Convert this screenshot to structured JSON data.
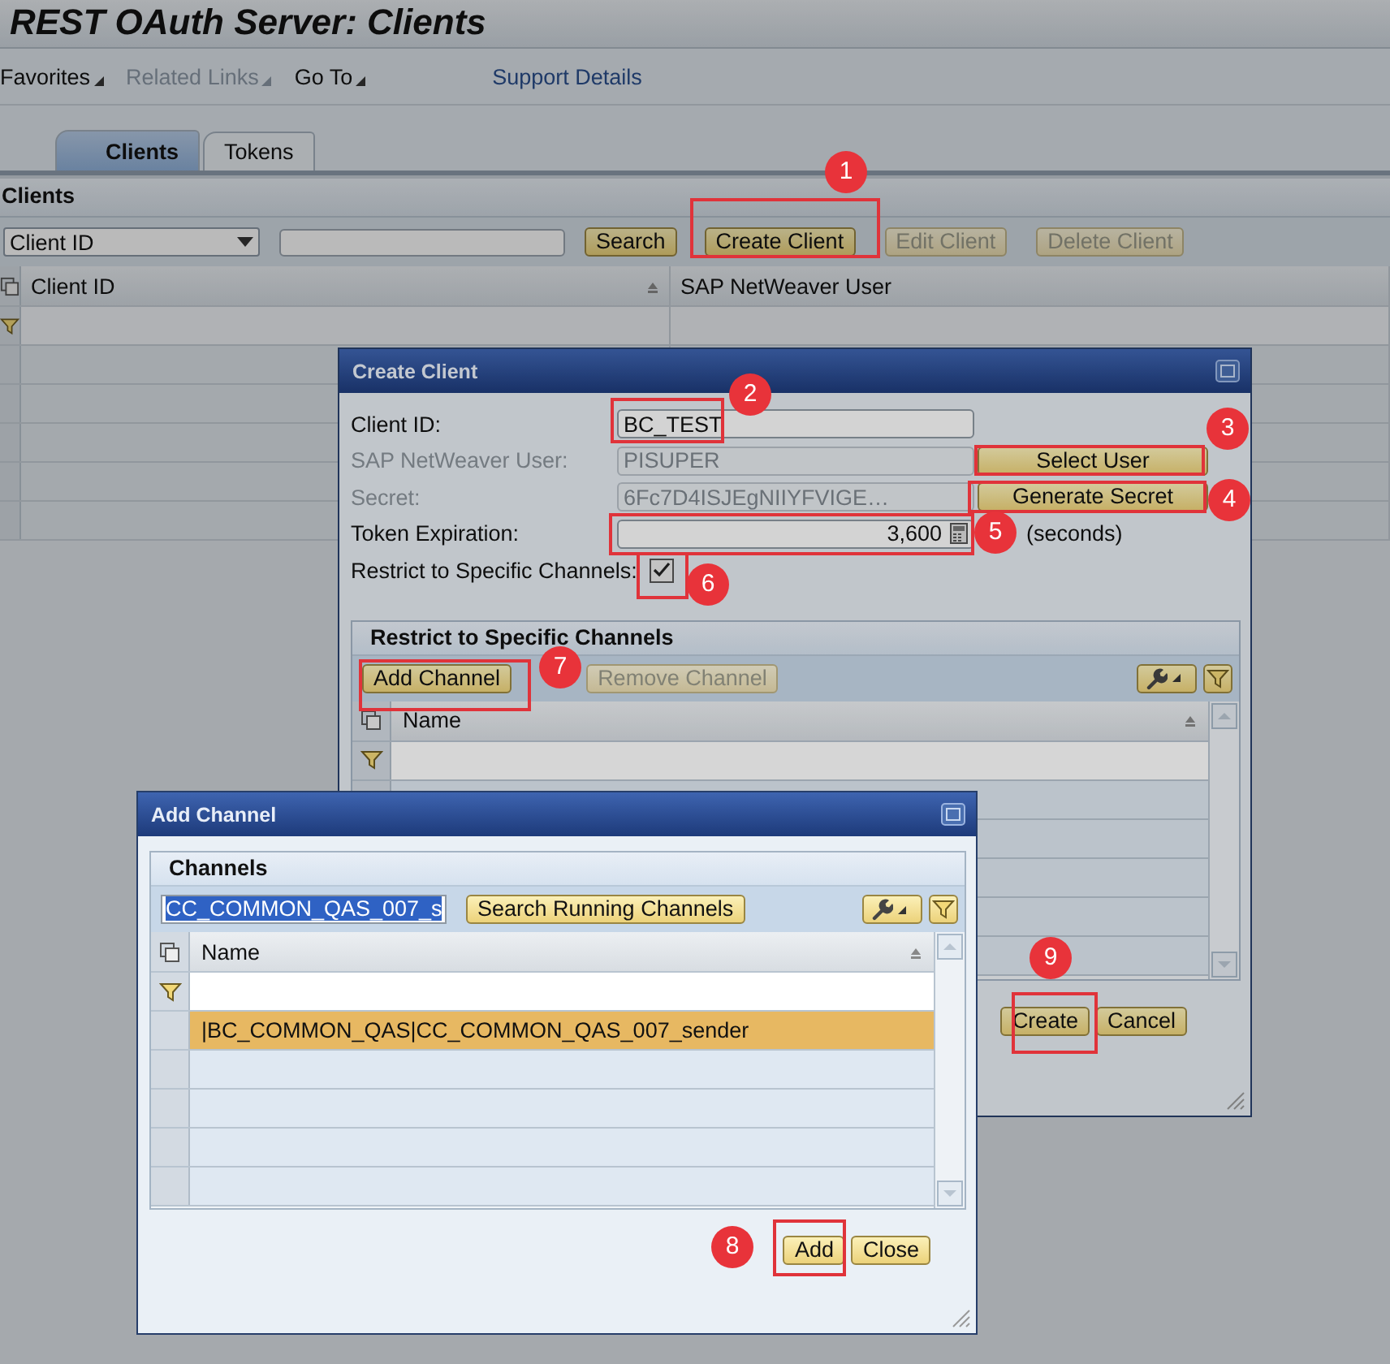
{
  "window": {
    "title": "REST OAuth Server: Clients"
  },
  "menu": [
    {
      "label": "Favorites",
      "disabled": false
    },
    {
      "label": "Related Links",
      "disabled": true
    },
    {
      "label": "Go To",
      "disabled": false
    }
  ],
  "support_link": "Support Details",
  "tabs": [
    {
      "label": "Clients",
      "selected": true
    },
    {
      "label": "Tokens",
      "selected": false
    }
  ],
  "clients_panel": {
    "title": "Clients",
    "search_by": "Client ID",
    "search_button": "Search",
    "buttons": [
      {
        "label": "Create Client",
        "disabled": false
      },
      {
        "label": "Edit Client",
        "disabled": true
      },
      {
        "label": "Delete Client",
        "disabled": true
      }
    ],
    "columns": [
      "Client ID",
      "SAP NetWeaver User"
    ]
  },
  "create_client_dialog": {
    "title": "Create Client",
    "fields": [
      {
        "kind": "text",
        "label": "Client ID:",
        "value": "BC_TEST",
        "disabled": false
      },
      {
        "kind": "text",
        "label": "SAP NetWeaver User:",
        "value": "PISUPER",
        "disabled": true,
        "button": "Select User"
      },
      {
        "kind": "text",
        "label": "Secret:",
        "value": "6Fc7D4ISJEgNIIYFVIGE…",
        "disabled": true,
        "button": "Generate Secret"
      },
      {
        "kind": "number",
        "label": "Token Expiration:",
        "value": "3,600",
        "disabled": false,
        "suffix": "(seconds)"
      },
      {
        "kind": "checkbox",
        "label": "Restrict to Specific Channels:",
        "checked": true,
        "disabled": false
      }
    ],
    "channels_panel": {
      "title": "Restrict to Specific Channels",
      "buttons": [
        {
          "label": "Add Channel",
          "disabled": false
        },
        {
          "label": "Remove Channel",
          "disabled": true
        }
      ],
      "columns": [
        "Name"
      ]
    },
    "buttons": [
      "Create",
      "Cancel"
    ]
  },
  "add_channel_dialog": {
    "title": "Add Channel",
    "panel_title": "Channels",
    "search_value": "CC_COMMON_QAS_007_s",
    "search_button": "Search Running Channels",
    "columns": [
      "Name"
    ],
    "rows": [
      {
        "name": "|BC_COMMON_QAS|CC_COMMON_QAS_007_sender",
        "selected": true
      }
    ],
    "buttons": [
      "Add",
      "Close"
    ]
  },
  "annotations": [
    {
      "number": "1"
    },
    {
      "number": "2"
    },
    {
      "number": "3"
    },
    {
      "number": "4"
    },
    {
      "number": "5"
    },
    {
      "number": "6"
    },
    {
      "number": "7"
    },
    {
      "number": "8"
    },
    {
      "number": "9"
    }
  ]
}
